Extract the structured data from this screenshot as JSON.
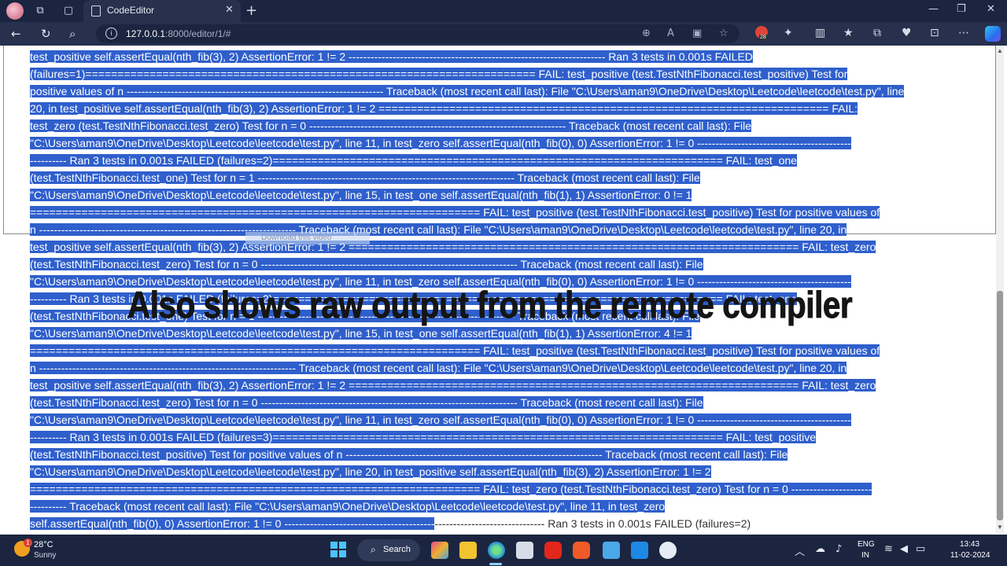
{
  "browser": {
    "tab_title": "CodeEditor",
    "url_host": "127.0.0.1",
    "url_path": ":8000/editor/1/#"
  },
  "extensions": {
    "badge_count": "28"
  },
  "output_lines": [
    {
      "text": "test_positive self.assertEqual(nth_fib(3), 2) AssertionError: 1 != 2 ---------------------------------------------------------------------- Ran 3 tests in 0.001s FAILED ",
      "plain": ""
    },
    {
      "text": "(failures=1)====================================================================== FAIL: test_positive (test.TestNthFibonacci.test_positive) Test for",
      "plain": ""
    },
    {
      "text": "positive values of n ---------------------------------------------------------------------- Traceback (most recent call last): File \"C:\\Users\\aman9\\OneDrive\\Desktop\\Leetcode\\leetcode\\test.py\", line",
      "plain": ""
    },
    {
      "text": "20, in test_positive self.assertEqual(nth_fib(3), 2) AssertionError: 1 != 2 ====================================================================== FAIL:",
      "plain": ""
    },
    {
      "text": "test_zero (test.TestNthFibonacci.test_zero) Test for n = 0 ---------------------------------------------------------------------- Traceback (most recent call last): File",
      "plain": ""
    },
    {
      "text": "\"C:\\Users\\aman9\\OneDrive\\Desktop\\Leetcode\\leetcode\\test.py\", line 11, in test_zero self.assertEqual(nth_fib(0), 0) AssertionError: 1 != 0 ------------------------------------------",
      "plain": ""
    },
    {
      "text": "---------- Ran 3 tests in 0.001s FAILED (failures=2)====================================================================== FAIL: test_one",
      "plain": ""
    },
    {
      "text": "(test.TestNthFibonacci.test_one) Test for n = 1 ---------------------------------------------------------------------- Traceback (most recent call last): File",
      "plain": ""
    },
    {
      "text": "\"C:\\Users\\aman9\\OneDrive\\Desktop\\Leetcode\\leetcode\\test.py\", line 15, in test_one self.assertEqual(nth_fib(1), 1) AssertionError: 0 != 1",
      "plain": ""
    },
    {
      "text": "====================================================================== FAIL: test_positive (test.TestNthFibonacci.test_positive) Test for positive values of",
      "plain": ""
    },
    {
      "text": "n ---------------------------------------------------------------------- Traceback (most recent call last): File \"C:\\Users\\aman9\\OneDrive\\Desktop\\Leetcode\\leetcode\\test.py\", line 20, in",
      "plain": ""
    },
    {
      "text": "test_positive self.assertEqual(nth_fib(3), 2) AssertionError: 1 != 2 ====================================================================== FAIL: test_zero",
      "plain": ""
    },
    {
      "text": "(test.TestNthFibonacci.test_zero) Test for n = 0 ---------------------------------------------------------------------- Traceback (most recent call last): File",
      "plain": ""
    },
    {
      "text": "\"C:\\Users\\aman9\\OneDrive\\Desktop\\Leetcode\\leetcode\\test.py\", line 11, in test_zero self.assertEqual(nth_fib(0), 0) AssertionError: 1 != 0 ------------------------------------------",
      "plain": ""
    },
    {
      "text": "---------- Ran 3 tests in 0.001s FAILED (failures=2)====================================================================== FAIL: test_one",
      "plain": ""
    },
    {
      "text": "(test.TestNthFibonacci.test_one) Test for n = 1 ---------------------------------------------------------------------- Traceback (most recent call last): File",
      "plain": ""
    },
    {
      "text": "\"C:\\Users\\aman9\\OneDrive\\Desktop\\Leetcode\\leetcode\\test.py\", line 15, in test_one self.assertEqual(nth_fib(1), 1) AssertionError: 4 != 1",
      "plain": ""
    },
    {
      "text": "====================================================================== FAIL: test_positive (test.TestNthFibonacci.test_positive) Test for positive values of",
      "plain": ""
    },
    {
      "text": "n ---------------------------------------------------------------------- Traceback (most recent call last): File \"C:\\Users\\aman9\\OneDrive\\Desktop\\Leetcode\\leetcode\\test.py\", line 20, in",
      "plain": ""
    },
    {
      "text": "test_positive self.assertEqual(nth_fib(3), 2) AssertionError: 1 != 2 ====================================================================== FAIL: test_zero",
      "plain": ""
    },
    {
      "text": "(test.TestNthFibonacci.test_zero) Test for n = 0 ---------------------------------------------------------------------- Traceback (most recent call last): File",
      "plain": ""
    },
    {
      "text": "\"C:\\Users\\aman9\\OneDrive\\Desktop\\Leetcode\\leetcode\\test.py\", line 11, in test_zero self.assertEqual(nth_fib(0), 0) AssertionError: 1 != 0 ------------------------------------------",
      "plain": ""
    },
    {
      "text": "---------- Ran 3 tests in 0.001s FAILED (failures=3)====================================================================== FAIL: test_positive",
      "plain": ""
    },
    {
      "text": "(test.TestNthFibonacci.test_positive) Test for positive values of n ---------------------------------------------------------------------- Traceback (most recent call last): File",
      "plain": ""
    },
    {
      "text": "\"C:\\Users\\aman9\\OneDrive\\Desktop\\Leetcode\\leetcode\\test.py\", line 20, in test_positive self.assertEqual(nth_fib(3), 2) AssertionError: 1 != 2",
      "plain": ""
    },
    {
      "text": "====================================================================== FAIL: test_zero (test.TestNthFibonacci.test_zero) Test for n = 0 ----------------------",
      "plain": ""
    },
    {
      "text": "---------- Traceback (most recent call last): File \"C:\\Users\\aman9\\OneDrive\\Desktop\\Leetcode\\leetcode\\test.py\", line 11, in test_zero",
      "plain": ""
    },
    {
      "text": "self.assertEqual(nth_fib(0), 0) AssertionError: 1 != 0 -----------------------------------------",
      "plain": "------------------------------ Ran 3 tests in 0.001s FAILED (failures=2)"
    }
  ],
  "overlay": {
    "download_chip": "Download this video",
    "caption": "Also shows raw output from the remote compiler"
  },
  "taskbar": {
    "weather_temp": "28°C",
    "weather_desc": "Sunny",
    "weather_badge": "1",
    "search_label": "Search",
    "lang_line1": "ENG",
    "lang_line2": "IN",
    "time": "13:43",
    "date": "11-02-2024"
  },
  "colors": {
    "selection": "#2f5fcc",
    "chrome_dark": "#1b2540",
    "chrome": "#27304d"
  }
}
